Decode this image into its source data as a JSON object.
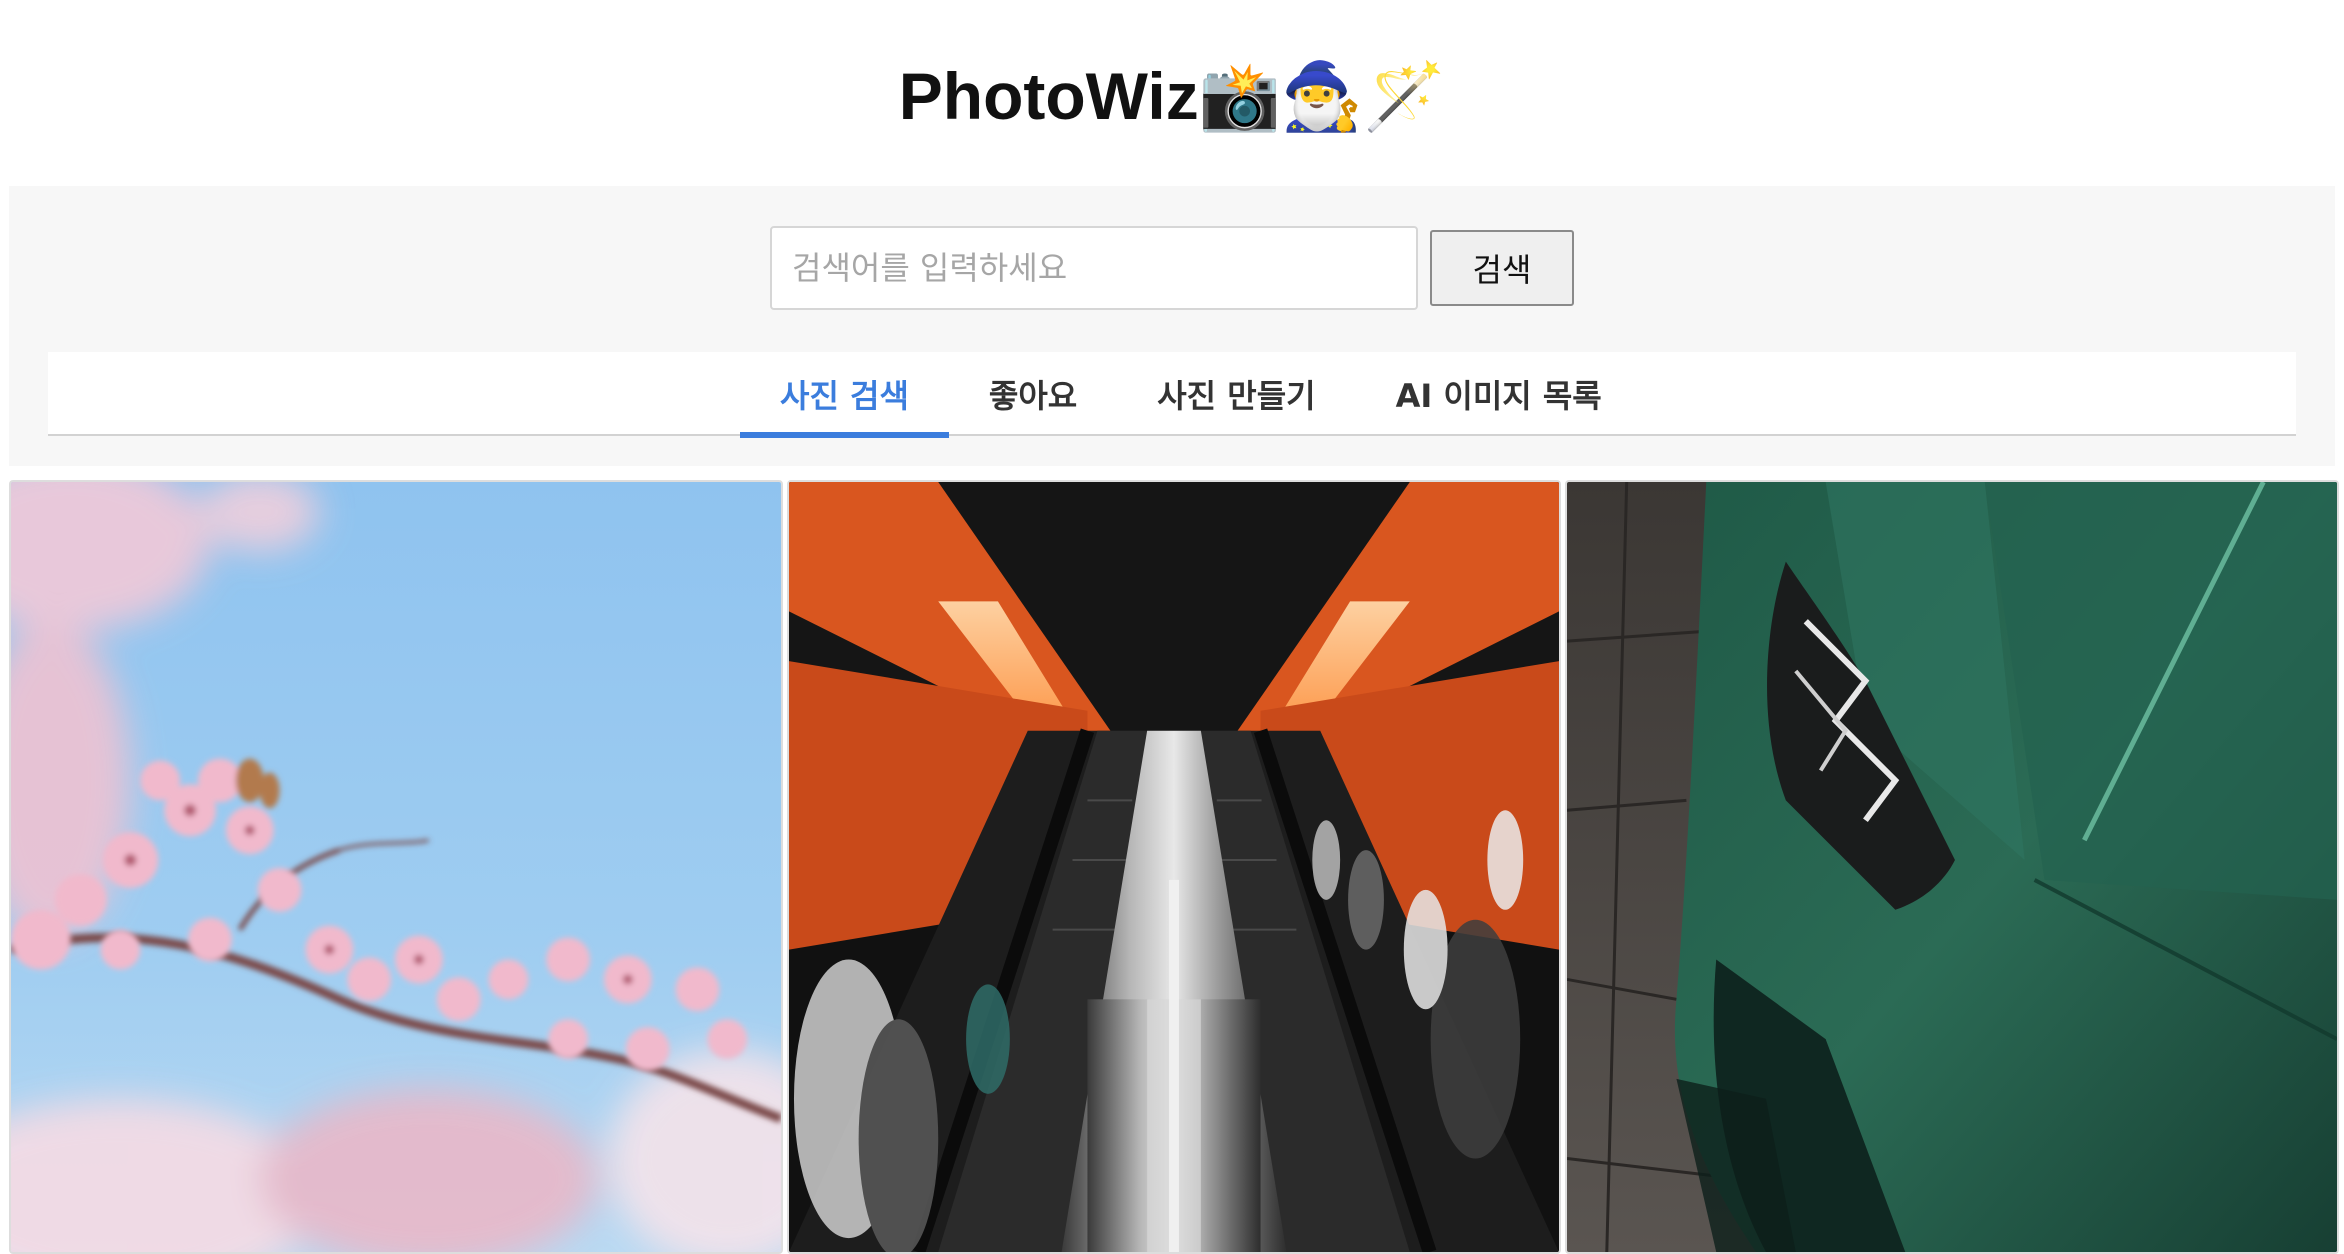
{
  "app": {
    "title": "PhotoWiz📸🧙‍♂️🪄"
  },
  "search": {
    "placeholder": "검색어를 입력하세요",
    "value": "",
    "button_label": "검색"
  },
  "tabs": [
    {
      "label": "사진 검색",
      "active": true
    },
    {
      "label": "좋아요",
      "active": false
    },
    {
      "label": "사진 만들기",
      "active": false
    },
    {
      "label": "AI 이미지 목록",
      "active": false
    }
  ],
  "colors": {
    "accent": "#3b7ddd",
    "panel_background": "#f7f7f7"
  },
  "photos": [
    {
      "subject": "cherry-blossom-photo"
    },
    {
      "subject": "escalator-photo"
    },
    {
      "subject": "green-car-photo"
    }
  ]
}
